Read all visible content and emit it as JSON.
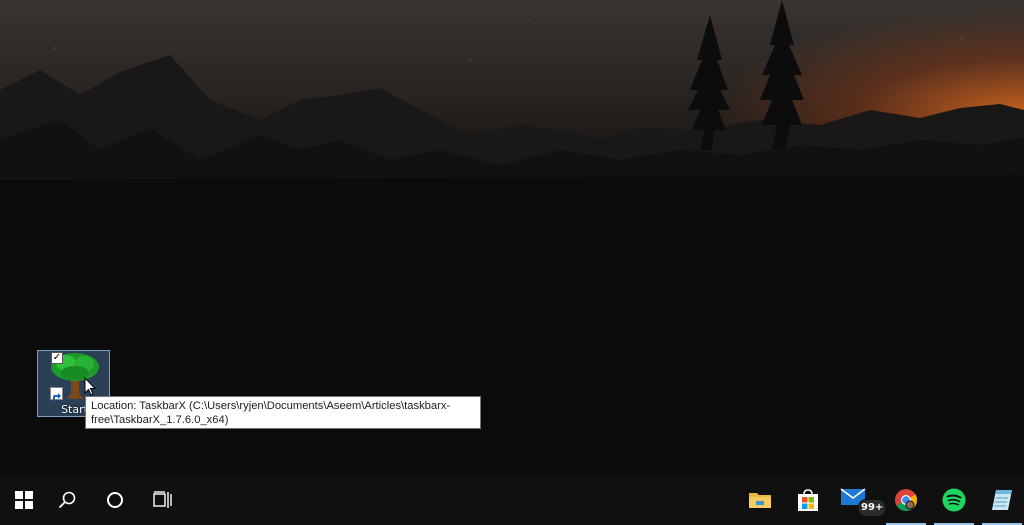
{
  "desktop": {
    "shortcut": {
      "label": "Start",
      "checked": true
    },
    "tooltip": {
      "text": "Location: TaskbarX (C:\\Users\\ryjen\\Documents\\Aseem\\Articles\\taskbarx-\nfree\\TaskbarX_1.7.6.0_x64)"
    }
  },
  "taskbar": {
    "left": [
      {
        "name": "start-button",
        "icon": "windows-logo-icon"
      },
      {
        "name": "search-button",
        "icon": "search-icon"
      },
      {
        "name": "cortana-button",
        "icon": "cortana-circle-icon"
      },
      {
        "name": "task-view-button",
        "icon": "task-view-icon"
      }
    ],
    "apps": [
      {
        "name": "file-explorer",
        "icon": "folder-icon",
        "active": false
      },
      {
        "name": "microsoft-store",
        "icon": "store-bag-icon",
        "active": false
      },
      {
        "name": "mail",
        "icon": "mail-icon",
        "badge": "99+",
        "active": false
      },
      {
        "name": "chrome",
        "icon": "chrome-icon",
        "active": true
      },
      {
        "name": "spotify",
        "icon": "spotify-icon",
        "active": true
      },
      {
        "name": "notepad-app",
        "icon": "notepad-icon",
        "active": true
      }
    ],
    "colors": {
      "background": "#101010",
      "active_indicator": "#99c2e8",
      "spotify_green": "#1ed760"
    }
  }
}
